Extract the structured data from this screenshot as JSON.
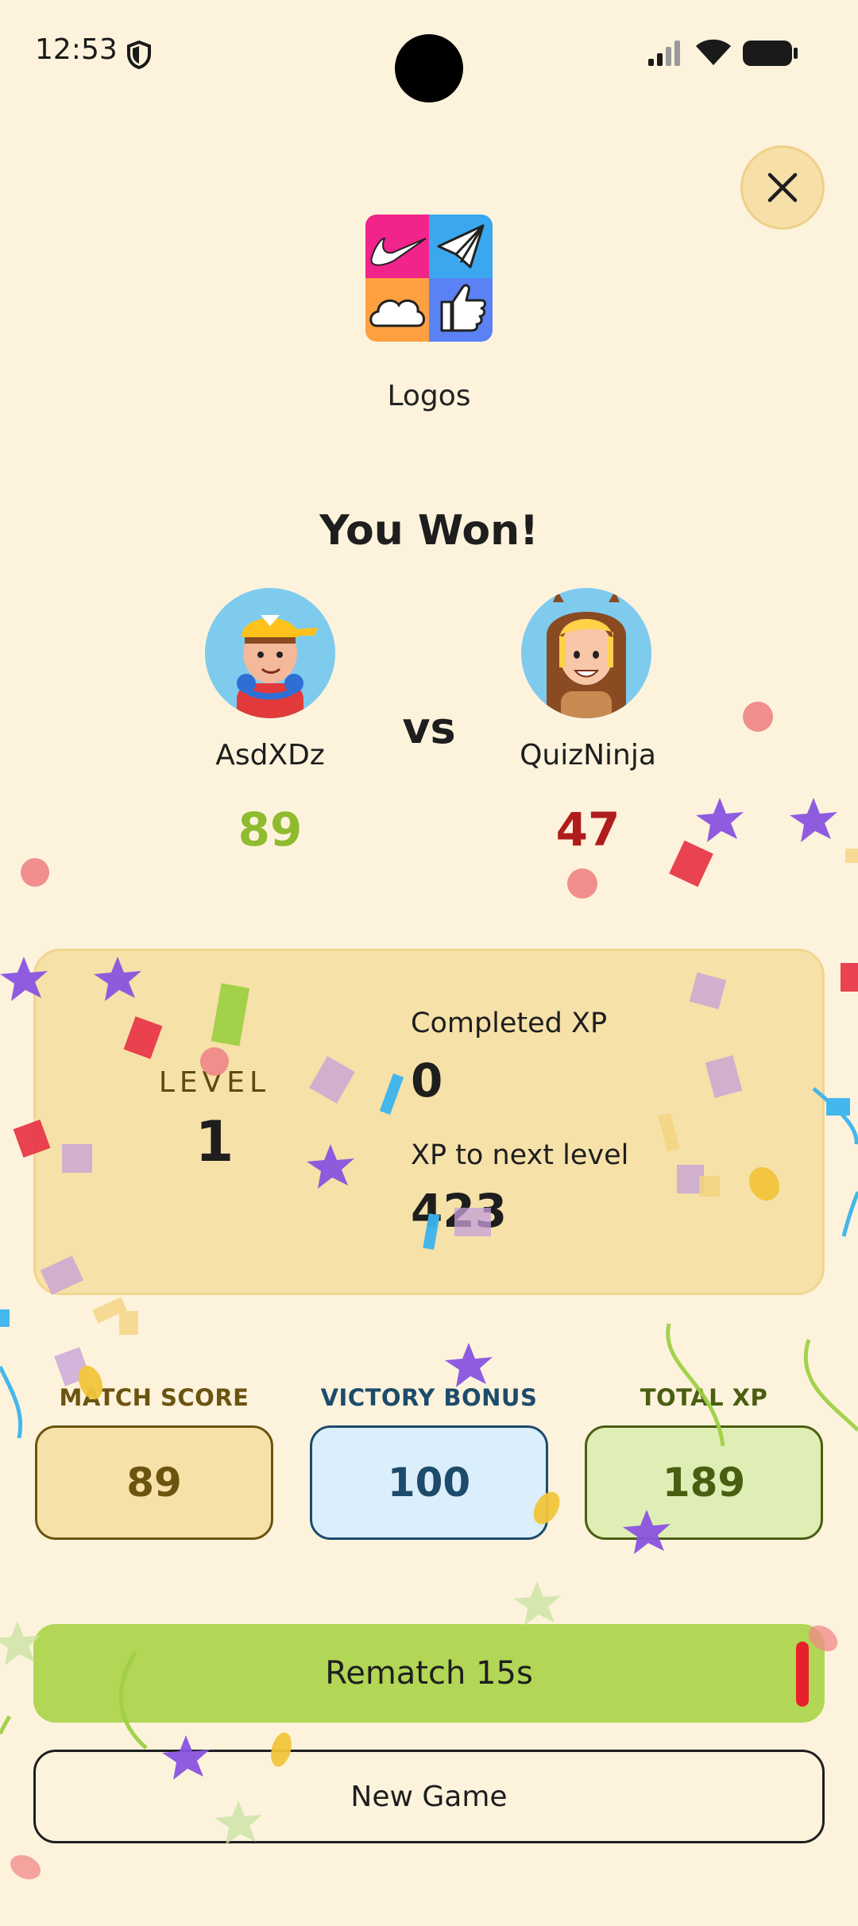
{
  "status_bar": {
    "time": "12:53"
  },
  "category": {
    "name": "Logos"
  },
  "result": {
    "title": "You Won!"
  },
  "players": [
    {
      "name": "AsdXDz",
      "score": "89"
    },
    {
      "name": "QuizNinja",
      "score": "47"
    }
  ],
  "vs_label": "vs",
  "level_card": {
    "level_label": "LEVEL",
    "level_value": "1",
    "completed_xp_label": "Completed XP",
    "completed_xp_value": "0",
    "next_level_label": "XP to next level",
    "next_level_value": "423"
  },
  "score_boxes": {
    "match_score": {
      "title": "MATCH SCORE",
      "value": "89"
    },
    "victory_bonus": {
      "title": "VICTORY BONUS",
      "value": "100"
    },
    "total_xp": {
      "title": "TOTAL XP",
      "value": "189"
    }
  },
  "buttons": {
    "rematch": "Rematch 15s",
    "new_game": "New Game"
  },
  "colors": {
    "background": "#fdf3dc",
    "winner_score": "#8fbb2e",
    "loser_score": "#b01c1c",
    "rematch_button": "#b2d655"
  },
  "icons": {
    "close": "close-icon",
    "category_tiles": [
      "swoosh-icon",
      "paper-plane-icon",
      "cloud-icon",
      "thumbs-up-icon"
    ]
  }
}
